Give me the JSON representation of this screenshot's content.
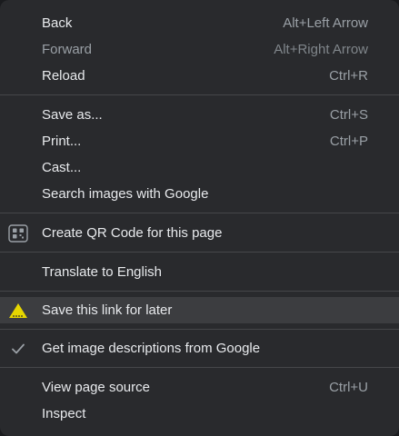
{
  "menu": {
    "nav": [
      {
        "label": "Back",
        "shortcut": "Alt+Left Arrow"
      },
      {
        "label": "Forward",
        "shortcut": "Alt+Right Arrow"
      },
      {
        "label": "Reload",
        "shortcut": "Ctrl+R"
      }
    ],
    "page": [
      {
        "label": "Save as...",
        "shortcut": "Ctrl+S"
      },
      {
        "label": "Print...",
        "shortcut": "Ctrl+P"
      },
      {
        "label": "Cast...",
        "shortcut": ""
      },
      {
        "label": "Search images with Google",
        "shortcut": ""
      }
    ],
    "qr": {
      "label": "Create QR Code for this page",
      "icon": "qr-code-icon"
    },
    "translate": {
      "label": "Translate to English"
    },
    "save_link": {
      "label": "Save this link for later",
      "icon": "warning-triangle-icon"
    },
    "image_desc": {
      "label": "Get image descriptions from Google",
      "icon": "checkmark-icon"
    },
    "dev": [
      {
        "label": "View page source",
        "shortcut": "Ctrl+U"
      },
      {
        "label": "Inspect",
        "shortcut": ""
      }
    ]
  },
  "colors": {
    "background": "#292a2d",
    "text": "#e8eaed",
    "shortcut": "#9aa0a6",
    "highlight": "#3c3d40",
    "separator": "#46474a",
    "warning_icon": "#e6d600"
  }
}
